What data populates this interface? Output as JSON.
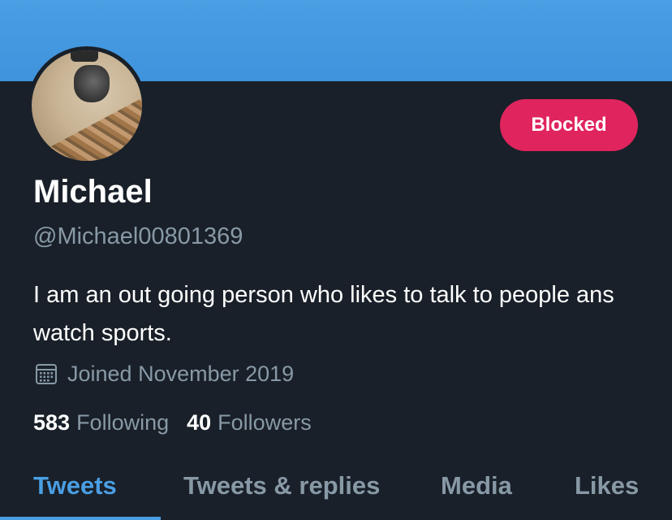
{
  "profile": {
    "name": "Michael",
    "handle": "@Michael00801369",
    "bio": "I am an out going person who likes to talk to people ans watch sports.",
    "joined": "Joined November 2019",
    "block_button": "Blocked",
    "stats": {
      "following_count": "583",
      "following_label": "Following",
      "followers_count": "40",
      "followers_label": "Followers"
    }
  },
  "tabs": [
    {
      "label": "Tweets",
      "active": true
    },
    {
      "label": "Tweets & replies",
      "active": false
    },
    {
      "label": "Media",
      "active": false
    },
    {
      "label": "Likes",
      "active": false
    }
  ],
  "icons": {
    "calendar": "calendar-icon"
  },
  "colors": {
    "banner": "#4a9ee3",
    "background": "#192029",
    "blocked_button": "#e0245e",
    "accent": "#4a9ee3",
    "muted_text": "#8899a6"
  }
}
